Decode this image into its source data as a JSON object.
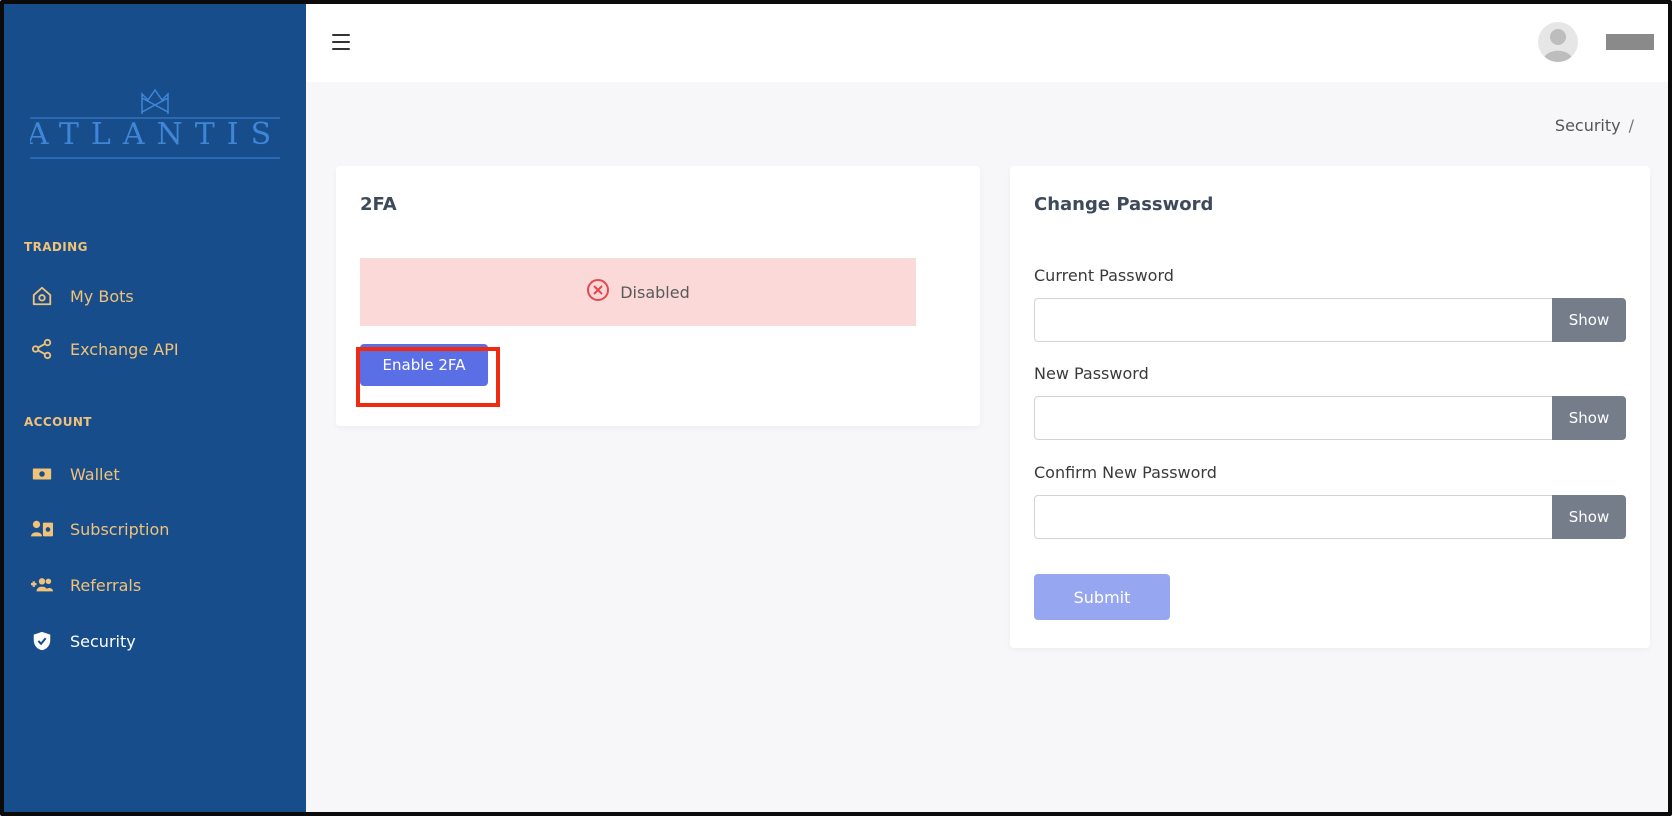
{
  "brand": {
    "logo_text": "ATLANTIS",
    "logo_color": "#4a8ee0"
  },
  "sidebar": {
    "sections": [
      {
        "title": "TRADING"
      },
      {
        "title": "ACCOUNT"
      }
    ],
    "items": [
      {
        "label": "My Bots",
        "icon": "home-robot-icon"
      },
      {
        "label": "Exchange API",
        "icon": "share-nodes-icon"
      },
      {
        "label": "Wallet",
        "icon": "wallet-icon"
      },
      {
        "label": "Subscription",
        "icon": "subscription-icon"
      },
      {
        "label": "Referrals",
        "icon": "user-plus-icon"
      },
      {
        "label": "Security",
        "icon": "shield-check-icon",
        "active": true
      }
    ]
  },
  "breadcrumb": {
    "current": "Security",
    "separator": "/"
  },
  "twofa": {
    "title": "2FA",
    "status_text": "Disabled",
    "status_icon": "x-circle-icon",
    "enable_button": "Enable 2FA"
  },
  "change_password": {
    "title": "Change Password",
    "fields": [
      {
        "label": "Current Password",
        "value": "",
        "show_label": "Show"
      },
      {
        "label": "New Password",
        "value": "",
        "show_label": "Show"
      },
      {
        "label": "Confirm New Password",
        "value": "",
        "show_label": "Show"
      }
    ],
    "submit_label": "Submit"
  },
  "colors": {
    "sidebar_bg": "#174d8b",
    "sidebar_text": "#f0c27a",
    "primary": "#5a6ee6",
    "alert_bg": "#fbd9d9",
    "highlight": "#ef2a11"
  }
}
